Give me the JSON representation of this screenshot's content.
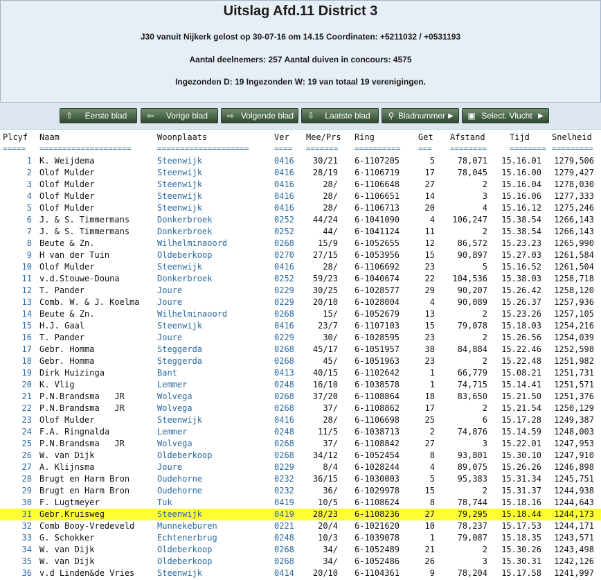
{
  "header": {
    "title": "Uitslag Afd.11 District 3",
    "line1": "J30 vanuit Nijkerk gelost op 30-07-16 om 14.15 Coordinaten: +5211032 / +0531193",
    "line2": "Aantal deelnemers: 257 Aantal duiven in concours: 4575",
    "line3": "Ingezonden D: 19 Ingezonden W: 19 van totaal 19 verenigingen."
  },
  "nav": [
    {
      "label": "Eerste blad",
      "icon": "arrow-up-icon"
    },
    {
      "label": "Vorige blad",
      "icon": "arrow-left-icon"
    },
    {
      "label": "Volgende blad",
      "icon": "arrow-right-icon"
    },
    {
      "label": "Laatste blad",
      "icon": "arrow-down-icon"
    },
    {
      "label": "Bladnummer",
      "icon": "search-icon"
    },
    {
      "label": "Select. Vlucht",
      "icon": "download-icon"
    }
  ],
  "table": {
    "columns": [
      "Plcyf",
      "Naam",
      "Woonplaats",
      "Ver",
      "Mee/Prs",
      "Ring",
      "Get",
      "Afstand",
      "Tijd",
      "Snelheid"
    ],
    "separators": [
      "=====",
      "====================",
      "====================",
      "====",
      "=======",
      "==========",
      "===",
      "========",
      "========",
      "========="
    ],
    "highlight_row": 31,
    "highlight_color": "#ffff33",
    "rows": [
      [
        "1",
        "K. Weijdema",
        "Steenwijk",
        "0416",
        "30/21",
        "6-1107205",
        "5",
        "78,071",
        "15.16.01",
        "1279,506"
      ],
      [
        "2",
        "Olof Mulder",
        "Steenwijk",
        "0416",
        "28/19",
        "6-1106719",
        "17",
        "78,045",
        "15.16.00",
        "1279,427"
      ],
      [
        "3",
        "Olof Mulder",
        "Steenwijk",
        "0416",
        "28/",
        "6-1106648",
        "27",
        "2",
        "15.16.04",
        "1278,030"
      ],
      [
        "4",
        "Olof Mulder",
        "Steenwijk",
        "0416",
        "28/",
        "6-1106651",
        "14",
        "3",
        "15.16.06",
        "1277,333"
      ],
      [
        "5",
        "Olof Mulder",
        "Steenwijk",
        "0416",
        "28/",
        "6-1106713",
        "20",
        "4",
        "15.16.12",
        "1275,246"
      ],
      [
        "6",
        "J. & S. Timmermans",
        "Donkerbroek",
        "0252",
        "44/24",
        "6-1041090",
        "4",
        "106,247",
        "15.38.54",
        "1266,143"
      ],
      [
        "7",
        "J. & S. Timmermans",
        "Donkerbroek",
        "0252",
        "44/",
        "6-1041124",
        "11",
        "2",
        "15.38.54",
        "1266,143"
      ],
      [
        "8",
        "Beute & Zn.",
        "Wilhelminaoord",
        "0268",
        "15/9",
        "6-1052655",
        "12",
        "86,572",
        "15.23.23",
        "1265,990"
      ],
      [
        "9",
        "H van der Tuin",
        "Oldeberkoop",
        "0270",
        "27/15",
        "6-1053956",
        "15",
        "90,897",
        "15.27.03",
        "1261,584"
      ],
      [
        "10",
        "Olof Mulder",
        "Steenwijk",
        "0416",
        "28/",
        "6-1106692",
        "23",
        "5",
        "15.16.52",
        "1261,504"
      ],
      [
        "11",
        "v.d.Stouwe-Douna",
        "Donkerbroek",
        "0252",
        "59/23",
        "6-1040674",
        "22",
        "104,536",
        "15.38.03",
        "1258,718"
      ],
      [
        "12",
        "T. Pander",
        "Joure",
        "0229",
        "30/25",
        "6-1028577",
        "29",
        "90,207",
        "15.26.42",
        "1258,120"
      ],
      [
        "13",
        "Comb. W. & J. Koelma",
        "Joure",
        "0229",
        "20/10",
        "6-1028004",
        "4",
        "90,089",
        "15.26.37",
        "1257,936"
      ],
      [
        "14",
        "Beute & Zn.",
        "Wilhelminaoord",
        "0268",
        "15/",
        "6-1052679",
        "13",
        "2",
        "15.23.26",
        "1257,105"
      ],
      [
        "15",
        "H.J. Gaal",
        "Steenwijk",
        "0416",
        "23/7",
        "6-1107103",
        "15",
        "79,078",
        "15.18.03",
        "1254,216"
      ],
      [
        "16",
        "T. Pander",
        "Joure",
        "0229",
        "30/",
        "6-1028595",
        "23",
        "2",
        "15.26.56",
        "1254,039"
      ],
      [
        "17",
        "Gebr. Homma",
        "Steggerda",
        "0268",
        "45/17",
        "6-1051957",
        "38",
        "84,884",
        "15.22.46",
        "1252,598"
      ],
      [
        "18",
        "Gebr. Homma",
        "Steggerda",
        "0268",
        "45/",
        "6-1051963",
        "23",
        "2",
        "15.22.48",
        "1251,982"
      ],
      [
        "19",
        "Dirk Huizinga",
        "Bant",
        "0413",
        "40/15",
        "6-1102642",
        "1",
        "66,779",
        "15.08.21",
        "1251,731"
      ],
      [
        "20",
        "K. Vlig",
        "Lemmer",
        "0248",
        "16/10",
        "6-1038578",
        "1",
        "74,715",
        "15.14.41",
        "1251,571"
      ],
      [
        "21",
        "P.N.Brandsma   JR",
        "Wolvega",
        "0268",
        "37/20",
        "6-1108864",
        "18",
        "83,650",
        "15.21.50",
        "1251,376"
      ],
      [
        "22",
        "P.N.Brandsma   JR",
        "Wolvega",
        "0268",
        "37/",
        "6-1108862",
        "17",
        "2",
        "15.21.54",
        "1250,129"
      ],
      [
        "23",
        "Olof Mulder",
        "Steenwijk",
        "0416",
        "28/",
        "6-1106698",
        "25",
        "6",
        "15.17.28",
        "1249,387"
      ],
      [
        "24",
        "F.A. Ringnalda",
        "Lemmer",
        "0248",
        "11/5",
        "6-1038713",
        "2",
        "74,876",
        "15.14.59",
        "1248,003"
      ],
      [
        "25",
        "P.N.Brandsma   JR",
        "Wolvega",
        "0268",
        "37/",
        "6-1108842",
        "27",
        "3",
        "15.22.01",
        "1247,953"
      ],
      [
        "26",
        "W. van Dijk",
        "Oldeberkoop",
        "0268",
        "34/12",
        "6-1052454",
        "8",
        "93,801",
        "15.30.10",
        "1247,910"
      ],
      [
        "27",
        "A. Klijnsma",
        "Joure",
        "0229",
        "8/4",
        "6-1028244",
        "4",
        "89,075",
        "15.26.26",
        "1246,898"
      ],
      [
        "28",
        "Brugt en Harm Bron",
        "Oudehorne",
        "0232",
        "36/15",
        "6-1030003",
        "5",
        "95,383",
        "15.31.34",
        "1245,751"
      ],
      [
        "29",
        "Brugt en Harm Bron",
        "Oudehorne",
        "0232",
        "36/",
        "6-1029978",
        "15",
        "2",
        "15.31.37",
        "1244,938"
      ],
      [
        "30",
        "F. Lugtmeyer",
        "Tuk",
        "0419",
        "10/5",
        "6-1108624",
        "8",
        "78,744",
        "15.18.16",
        "1244,643"
      ],
      [
        "31",
        "Gebr.Kruisweg",
        "Steenwijk",
        "0419",
        "28/23",
        "6-1108236",
        "27",
        "79,295",
        "15.18.44",
        "1244,173"
      ],
      [
        "32",
        "Comb Booy-Vredeveld",
        "Munnekeburen",
        "0221",
        "20/4",
        "6-1021620",
        "10",
        "78,237",
        "15.17.53",
        "1244,171"
      ],
      [
        "33",
        "G. Schokker",
        "Echtenerbrug",
        "0248",
        "10/3",
        "6-1039078",
        "1",
        "79,087",
        "15.18.35",
        "1243,571"
      ],
      [
        "34",
        "W. van Dijk",
        "Oldeberkoop",
        "0268",
        "34/",
        "6-1052489",
        "21",
        "2",
        "15.30.26",
        "1243,498"
      ],
      [
        "35",
        "W. van Dijk",
        "Oldeberkoop",
        "0268",
        "34/",
        "6-1052486",
        "26",
        "3",
        "15.30.31",
        "1242,126"
      ],
      [
        "36",
        "v.d Linden&de Vries",
        "Steenwijk",
        "0414",
        "20/10",
        "6-1104361",
        "9",
        "78,204",
        "15.17.58",
        "1241,997"
      ]
    ]
  }
}
